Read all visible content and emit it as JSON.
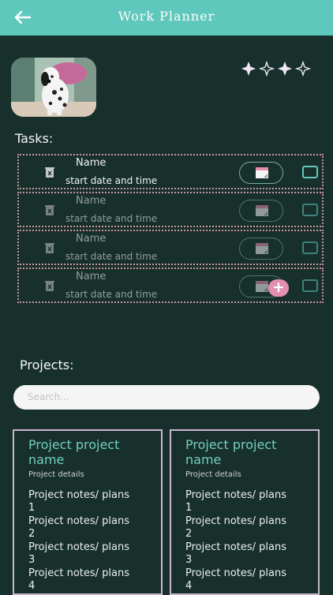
{
  "header": {
    "title": "Work Planner",
    "back_icon": "back-arrow-icon"
  },
  "profile": {
    "avatar_icon": "dalmatian-photo",
    "sparkle_icon": "sparkles-icon"
  },
  "tasks_section": {
    "label": "Tasks:"
  },
  "tasks": [
    {
      "name": "Name",
      "datetime": "start date and time"
    },
    {
      "name": "Name",
      "datetime": "start date and time"
    },
    {
      "name": "Name",
      "datetime": "start date and time"
    },
    {
      "name": "Name",
      "datetime": "start date and time"
    }
  ],
  "add_task": {
    "label": "+"
  },
  "projects_section": {
    "label": "Projects:"
  },
  "search": {
    "placeholder": "Search..."
  },
  "projects": [
    {
      "title": "Project project name",
      "details": "Project details",
      "notes": [
        "Project notes/ plans 1",
        "Project notes/ plans 2",
        "Project notes/ plans 3",
        "Project notes/ plans 4"
      ]
    },
    {
      "title": "Project project name",
      "details": "Project details",
      "notes": [
        "Project notes/ plans 1",
        "Project notes/ plans 2",
        "Project notes/ plans 3",
        "Project notes/ plans 4"
      ]
    }
  ],
  "colors": {
    "background": "#17302b",
    "header": "#5fc8bd",
    "accent_pink": "#e58fb0",
    "project_title": "#72cdbf"
  }
}
